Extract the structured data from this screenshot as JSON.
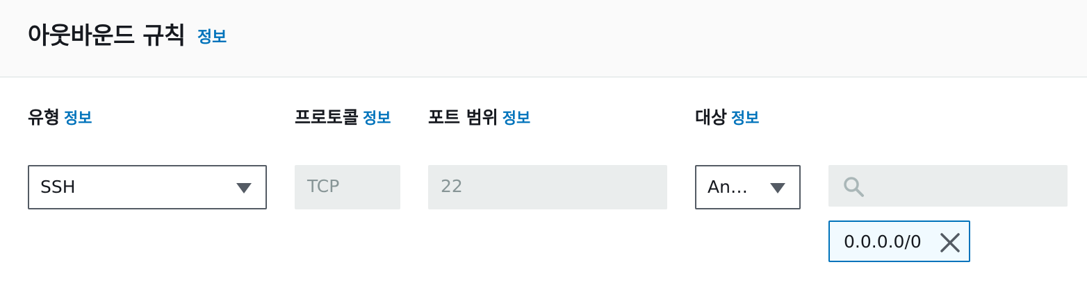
{
  "header": {
    "title": "아웃바운드 규칙",
    "info_label": "정보"
  },
  "columns": {
    "type": {
      "label": "유형",
      "info_label": "정보"
    },
    "protocol": {
      "label": "프로토콜",
      "info_label": "정보"
    },
    "port_range": {
      "label": "포트 범위",
      "info_label": "정보"
    },
    "destination": {
      "label": "대상",
      "info_label": "정보"
    }
  },
  "rule": {
    "type_value": "SSH",
    "protocol_value": "TCP",
    "port_range_value": "22",
    "destination_select_value": "An…",
    "destination_search_value": "",
    "destination_token": "0.0.0.0/0"
  },
  "icons": {
    "type_caret": "caret-down-icon",
    "destination_caret": "caret-down-icon",
    "search": "search-icon",
    "token_remove": "close-icon"
  },
  "colors": {
    "link": "#0073bb",
    "text": "#16191f",
    "disabled_bg": "#eaeded",
    "disabled_text": "#879596",
    "token_border": "#0073bb",
    "token_bg": "#f1faff"
  }
}
